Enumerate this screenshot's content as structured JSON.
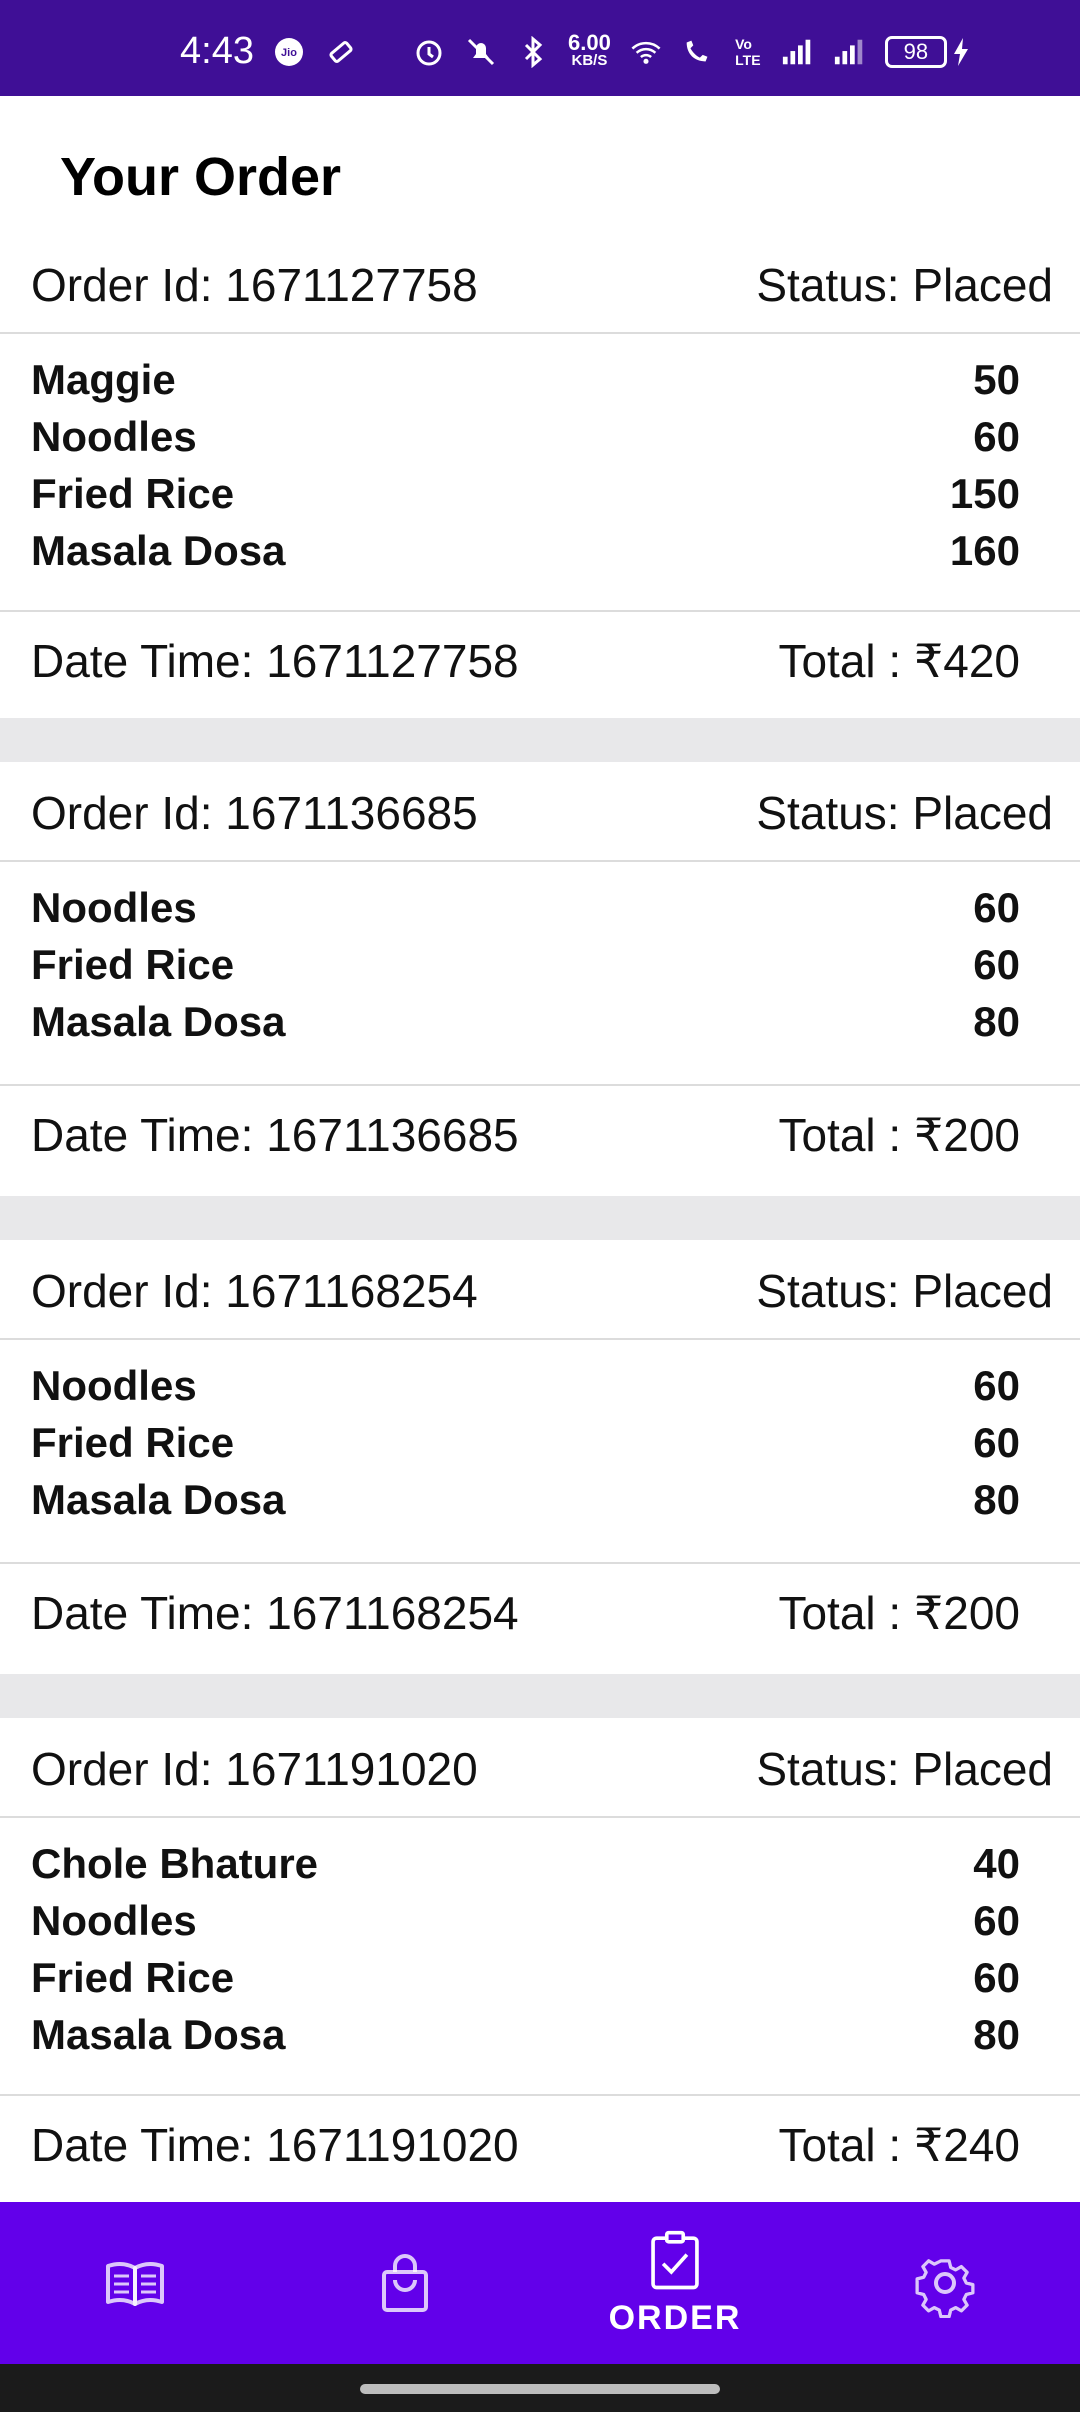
{
  "status_bar": {
    "time": "4:43",
    "net_speed_value": "6.00",
    "net_speed_unit": "KB/S",
    "battery": "98"
  },
  "header": {
    "title": "Your Order"
  },
  "orders": [
    {
      "id_text": "Order Id: 1671127758",
      "status_text": "Status: Placed",
      "items": [
        {
          "name": "Maggie",
          "price": "50"
        },
        {
          "name": "Noodles",
          "price": "60"
        },
        {
          "name": "Fried Rice",
          "price": "150"
        },
        {
          "name": "Masala Dosa",
          "price": "160"
        }
      ],
      "date_text": "Date Time: 1671127758",
      "total_text": "Total : ₹420"
    },
    {
      "id_text": "Order Id: 1671136685",
      "status_text": "Status: Placed",
      "items": [
        {
          "name": "Noodles",
          "price": "60"
        },
        {
          "name": "Fried Rice",
          "price": "60"
        },
        {
          "name": "Masala Dosa",
          "price": "80"
        }
      ],
      "date_text": "Date Time: 1671136685",
      "total_text": "Total : ₹200"
    },
    {
      "id_text": "Order Id: 1671168254",
      "status_text": "Status: Placed",
      "items": [
        {
          "name": "Noodles",
          "price": "60"
        },
        {
          "name": "Fried Rice",
          "price": "60"
        },
        {
          "name": "Masala Dosa",
          "price": "80"
        }
      ],
      "date_text": "Date Time: 1671168254",
      "total_text": "Total : ₹200"
    },
    {
      "id_text": "Order Id: 1671191020",
      "status_text": "Status: Placed",
      "items": [
        {
          "name": "Chole Bhature",
          "price": "40"
        },
        {
          "name": "Noodles",
          "price": "60"
        },
        {
          "name": "Fried Rice",
          "price": "60"
        },
        {
          "name": "Masala Dosa",
          "price": "80"
        }
      ],
      "date_text": "Date Time: 1671191020",
      "total_text": "Total : ₹240"
    }
  ],
  "bottom_nav": {
    "items": [
      {
        "icon": "menu-book-icon",
        "label": ""
      },
      {
        "icon": "shopping-bag-icon",
        "label": ""
      },
      {
        "icon": "order-clipboard-icon",
        "label": "ORDER"
      },
      {
        "icon": "settings-gear-icon",
        "label": ""
      }
    ],
    "active_index": 2,
    "color": "#6200ea"
  },
  "colors": {
    "status_bar": "#3f0f96",
    "nav": "#6200ea",
    "separator": "#e8e8ea"
  }
}
